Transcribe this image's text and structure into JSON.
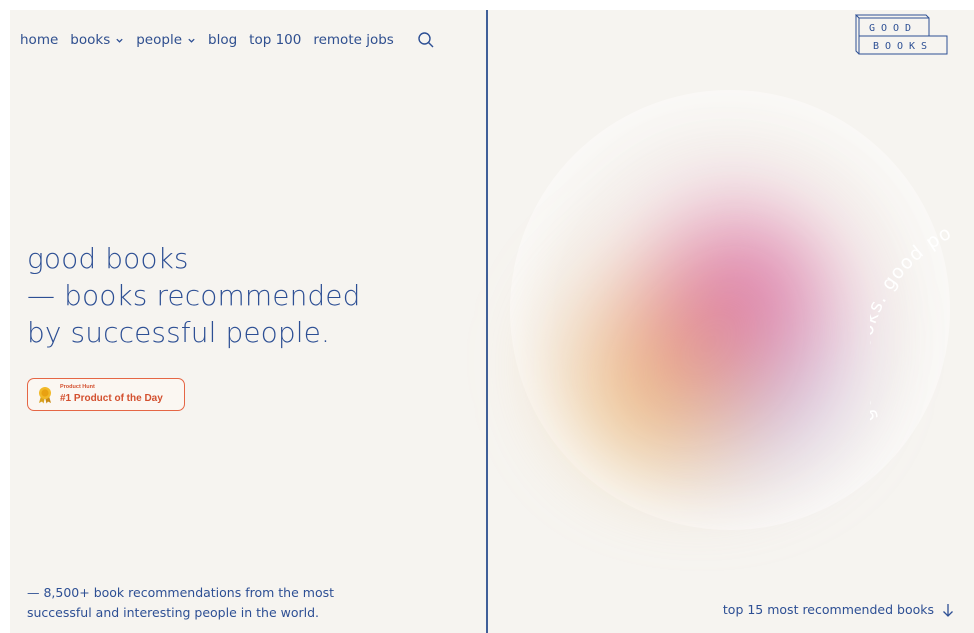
{
  "nav": {
    "items": [
      {
        "label": "home",
        "dropdown": false
      },
      {
        "label": "books",
        "dropdown": true
      },
      {
        "label": "people",
        "dropdown": true
      },
      {
        "label": "blog",
        "dropdown": false
      },
      {
        "label": "top 100",
        "dropdown": false
      },
      {
        "label": "remote jobs",
        "dropdown": false
      }
    ],
    "search_icon": "search-icon"
  },
  "hero": {
    "line1": "good books",
    "line2": "— books recommended",
    "line3": "by successful people."
  },
  "badge": {
    "small": "Product Hunt",
    "main": "#1 Product of the Day",
    "icon": "medal-icon"
  },
  "footer": {
    "line1": "— 8,500+ book recommendations from the most",
    "line2": "successful and interesting people in the world."
  },
  "logo": {
    "row1": "GOOD",
    "row2": "BOOKS"
  },
  "ring_text": "good books. good po",
  "bottom_link": {
    "label": "top 15 most recommended books",
    "icon": "arrow-down-icon"
  },
  "colors": {
    "background": "#f6f4f0",
    "text": "#2d4f94",
    "badge_accent": "#e56645"
  }
}
